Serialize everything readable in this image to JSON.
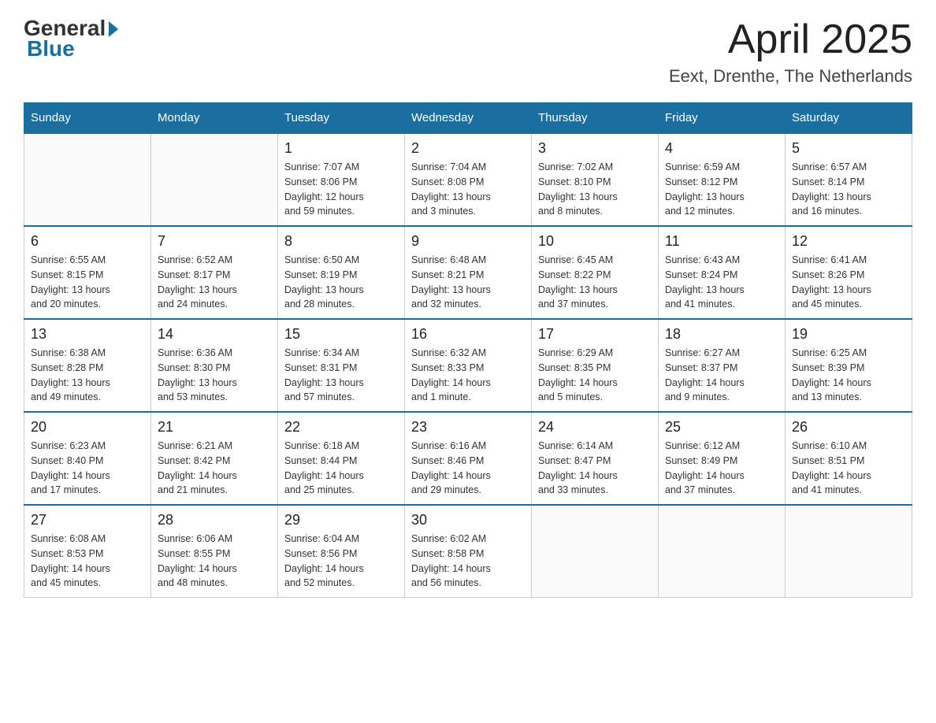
{
  "logo": {
    "general": "General",
    "blue": "Blue"
  },
  "title": {
    "month": "April 2025",
    "location": "Eext, Drenthe, The Netherlands"
  },
  "days_of_week": [
    "Sunday",
    "Monday",
    "Tuesday",
    "Wednesday",
    "Thursday",
    "Friday",
    "Saturday"
  ],
  "weeks": [
    [
      {
        "day": "",
        "info": ""
      },
      {
        "day": "",
        "info": ""
      },
      {
        "day": "1",
        "info": "Sunrise: 7:07 AM\nSunset: 8:06 PM\nDaylight: 12 hours\nand 59 minutes."
      },
      {
        "day": "2",
        "info": "Sunrise: 7:04 AM\nSunset: 8:08 PM\nDaylight: 13 hours\nand 3 minutes."
      },
      {
        "day": "3",
        "info": "Sunrise: 7:02 AM\nSunset: 8:10 PM\nDaylight: 13 hours\nand 8 minutes."
      },
      {
        "day": "4",
        "info": "Sunrise: 6:59 AM\nSunset: 8:12 PM\nDaylight: 13 hours\nand 12 minutes."
      },
      {
        "day": "5",
        "info": "Sunrise: 6:57 AM\nSunset: 8:14 PM\nDaylight: 13 hours\nand 16 minutes."
      }
    ],
    [
      {
        "day": "6",
        "info": "Sunrise: 6:55 AM\nSunset: 8:15 PM\nDaylight: 13 hours\nand 20 minutes."
      },
      {
        "day": "7",
        "info": "Sunrise: 6:52 AM\nSunset: 8:17 PM\nDaylight: 13 hours\nand 24 minutes."
      },
      {
        "day": "8",
        "info": "Sunrise: 6:50 AM\nSunset: 8:19 PM\nDaylight: 13 hours\nand 28 minutes."
      },
      {
        "day": "9",
        "info": "Sunrise: 6:48 AM\nSunset: 8:21 PM\nDaylight: 13 hours\nand 32 minutes."
      },
      {
        "day": "10",
        "info": "Sunrise: 6:45 AM\nSunset: 8:22 PM\nDaylight: 13 hours\nand 37 minutes."
      },
      {
        "day": "11",
        "info": "Sunrise: 6:43 AM\nSunset: 8:24 PM\nDaylight: 13 hours\nand 41 minutes."
      },
      {
        "day": "12",
        "info": "Sunrise: 6:41 AM\nSunset: 8:26 PM\nDaylight: 13 hours\nand 45 minutes."
      }
    ],
    [
      {
        "day": "13",
        "info": "Sunrise: 6:38 AM\nSunset: 8:28 PM\nDaylight: 13 hours\nand 49 minutes."
      },
      {
        "day": "14",
        "info": "Sunrise: 6:36 AM\nSunset: 8:30 PM\nDaylight: 13 hours\nand 53 minutes."
      },
      {
        "day": "15",
        "info": "Sunrise: 6:34 AM\nSunset: 8:31 PM\nDaylight: 13 hours\nand 57 minutes."
      },
      {
        "day": "16",
        "info": "Sunrise: 6:32 AM\nSunset: 8:33 PM\nDaylight: 14 hours\nand 1 minute."
      },
      {
        "day": "17",
        "info": "Sunrise: 6:29 AM\nSunset: 8:35 PM\nDaylight: 14 hours\nand 5 minutes."
      },
      {
        "day": "18",
        "info": "Sunrise: 6:27 AM\nSunset: 8:37 PM\nDaylight: 14 hours\nand 9 minutes."
      },
      {
        "day": "19",
        "info": "Sunrise: 6:25 AM\nSunset: 8:39 PM\nDaylight: 14 hours\nand 13 minutes."
      }
    ],
    [
      {
        "day": "20",
        "info": "Sunrise: 6:23 AM\nSunset: 8:40 PM\nDaylight: 14 hours\nand 17 minutes."
      },
      {
        "day": "21",
        "info": "Sunrise: 6:21 AM\nSunset: 8:42 PM\nDaylight: 14 hours\nand 21 minutes."
      },
      {
        "day": "22",
        "info": "Sunrise: 6:18 AM\nSunset: 8:44 PM\nDaylight: 14 hours\nand 25 minutes."
      },
      {
        "day": "23",
        "info": "Sunrise: 6:16 AM\nSunset: 8:46 PM\nDaylight: 14 hours\nand 29 minutes."
      },
      {
        "day": "24",
        "info": "Sunrise: 6:14 AM\nSunset: 8:47 PM\nDaylight: 14 hours\nand 33 minutes."
      },
      {
        "day": "25",
        "info": "Sunrise: 6:12 AM\nSunset: 8:49 PM\nDaylight: 14 hours\nand 37 minutes."
      },
      {
        "day": "26",
        "info": "Sunrise: 6:10 AM\nSunset: 8:51 PM\nDaylight: 14 hours\nand 41 minutes."
      }
    ],
    [
      {
        "day": "27",
        "info": "Sunrise: 6:08 AM\nSunset: 8:53 PM\nDaylight: 14 hours\nand 45 minutes."
      },
      {
        "day": "28",
        "info": "Sunrise: 6:06 AM\nSunset: 8:55 PM\nDaylight: 14 hours\nand 48 minutes."
      },
      {
        "day": "29",
        "info": "Sunrise: 6:04 AM\nSunset: 8:56 PM\nDaylight: 14 hours\nand 52 minutes."
      },
      {
        "day": "30",
        "info": "Sunrise: 6:02 AM\nSunset: 8:58 PM\nDaylight: 14 hours\nand 56 minutes."
      },
      {
        "day": "",
        "info": ""
      },
      {
        "day": "",
        "info": ""
      },
      {
        "day": "",
        "info": ""
      }
    ]
  ]
}
